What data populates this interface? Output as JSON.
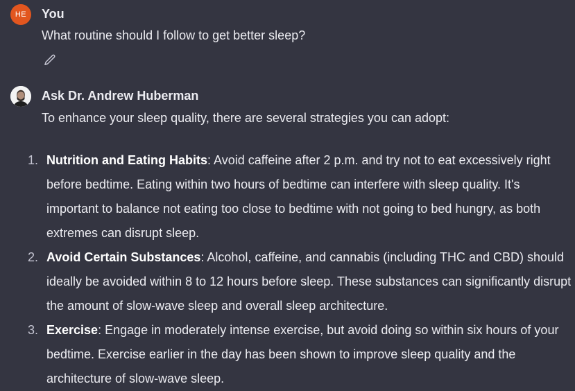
{
  "conversation": {
    "user_message": {
      "avatar_initials": "HE",
      "author": "You",
      "text": "What routine should I follow to get better sleep?",
      "edit_icon": "pencil-icon"
    },
    "assistant_message": {
      "author": "Ask Dr. Andrew Huberman",
      "avatar_icon": "portrait-avatar",
      "intro": "To enhance your sleep quality, there are several strategies you can adopt:",
      "items": [
        {
          "number": "1.",
          "title": "Nutrition and Eating Habits",
          "text": ": Avoid caffeine after 2 p.m. and try not to eat excessively right before bedtime. Eating within two hours of bedtime can interfere with sleep quality. It's important to balance not eating too close to bedtime with not going to bed hungry, as both extremes can disrupt sleep."
        },
        {
          "number": "2.",
          "title": "Avoid Certain Substances",
          "text": ": Alcohol, caffeine, and cannabis (including THC and CBD) should ideally be avoided within 8 to 12 hours before sleep. These substances can significantly disrupt the amount of slow-wave sleep and overall sleep architecture."
        },
        {
          "number": "3.",
          "title": "Exercise",
          "text": ": Engage in moderately intense exercise, but avoid doing so within six hours of your bedtime. Exercise earlier in the day has been shown to improve sleep quality and the architecture of slow-wave sleep."
        }
      ]
    }
  },
  "colors": {
    "background": "#343541",
    "text": "#ececf1",
    "user_avatar": "#e2561f"
  }
}
